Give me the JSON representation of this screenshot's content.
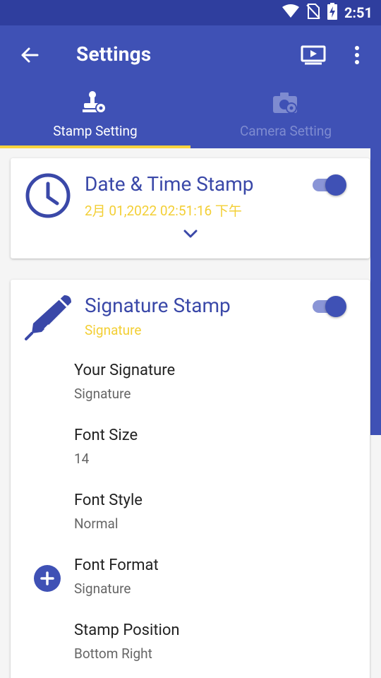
{
  "status_bar": {
    "time": "2:51"
  },
  "toolbar": {
    "title": "Settings"
  },
  "tabs": [
    {
      "label": "Stamp Setting",
      "active": true
    },
    {
      "label": "Camera Setting",
      "active": false
    }
  ],
  "date_time_card": {
    "title": "Date & Time Stamp",
    "subtitle": "2月 01,2022 02:51:16 下午",
    "enabled": true
  },
  "signature_card": {
    "title": "Signature Stamp",
    "subtitle": "Signature",
    "enabled": true,
    "settings": [
      {
        "label": "Your Signature",
        "value": "Signature"
      },
      {
        "label": "Font Size",
        "value": "14"
      },
      {
        "label": "Font Style",
        "value": "Normal"
      },
      {
        "label": "Font Format",
        "value": "Signature"
      },
      {
        "label": "Stamp Position",
        "value": "Bottom Right"
      }
    ]
  },
  "colors": {
    "primary": "#3f51b5",
    "status_bar": "#2f3e9e",
    "accent_yellow": "#f3cf35",
    "tab_inactive": "#7e8bd0"
  }
}
